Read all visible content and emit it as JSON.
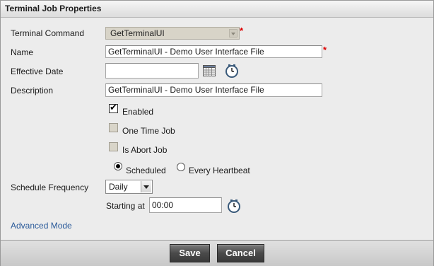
{
  "dialog": {
    "title": "Terminal Job Properties"
  },
  "fields": {
    "terminal_command": {
      "label": "Terminal Command",
      "value": "GetTerminalUI",
      "required": "*"
    },
    "name": {
      "label": "Name",
      "value": "GetTerminalUI - Demo User Interface File",
      "required": "*"
    },
    "effective_date": {
      "label": "Effective Date",
      "value": ""
    },
    "description": {
      "label": "Description",
      "value": "GetTerminalUI - Demo User Interface File"
    }
  },
  "options": {
    "enabled": {
      "label": "Enabled",
      "checked": true
    },
    "one_time_job": {
      "label": "One Time Job",
      "checked": false
    },
    "is_abort_job": {
      "label": "Is Abort Job",
      "checked": false
    }
  },
  "schedule_mode": {
    "scheduled": {
      "label": "Scheduled",
      "selected": true
    },
    "every_heartbeat": {
      "label": "Every Heartbeat",
      "selected": false
    }
  },
  "schedule": {
    "frequency_label": "Schedule Frequency",
    "frequency_value": "Daily",
    "starting_at_label": "Starting at",
    "starting_at_value": "00:00"
  },
  "advanced_mode_link": "Advanced Mode",
  "footer": {
    "save_label": "Save",
    "cancel_label": "Cancel"
  },
  "icons": {
    "calendar": "calendar-icon",
    "clock": "clock-icon"
  },
  "colors": {
    "required": "#dd0000",
    "link": "#2a5a9a",
    "button": "#4a4a4a"
  }
}
